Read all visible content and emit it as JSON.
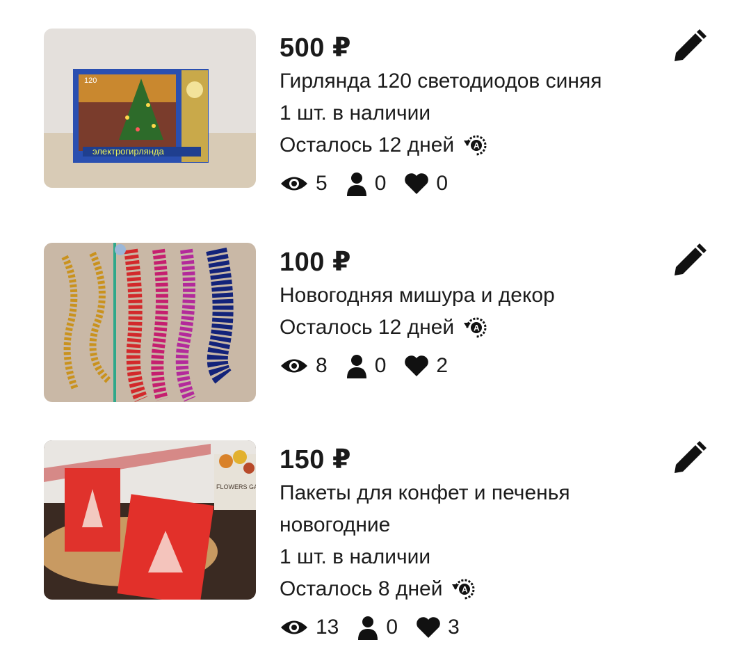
{
  "listings": [
    {
      "price": "500 ₽",
      "title_lines": [
        "Гирлянда 120 светодиодов синяя"
      ],
      "stock": "1 шт. в наличии",
      "remaining": "Осталось 12 дней",
      "views": "5",
      "contacts": "0",
      "favorites": "0",
      "image_text": "электрогирлянда",
      "image_label": "120"
    },
    {
      "price": "100 ₽",
      "title_lines": [
        "Новогодняя мишура и декор"
      ],
      "stock": "",
      "remaining": "Осталось 12 дней",
      "views": "8",
      "contacts": "0",
      "favorites": "2"
    },
    {
      "price": "150 ₽",
      "title_lines": [
        "Пакеты для конфет и печенья",
        "новогодние"
      ],
      "stock": "1 шт. в наличии",
      "remaining": "Осталось 8 дней",
      "views": "13",
      "contacts": "0",
      "favorites": "3",
      "image_text": "FLOWERS GARDEN"
    }
  ],
  "icons": {
    "views": "eye-icon",
    "contacts": "person-icon",
    "favorites": "heart-icon",
    "edit": "pencil-icon",
    "autorenew": "autorenew-icon"
  },
  "colors": {
    "text": "#1a1a1a",
    "background": "#ffffff"
  }
}
